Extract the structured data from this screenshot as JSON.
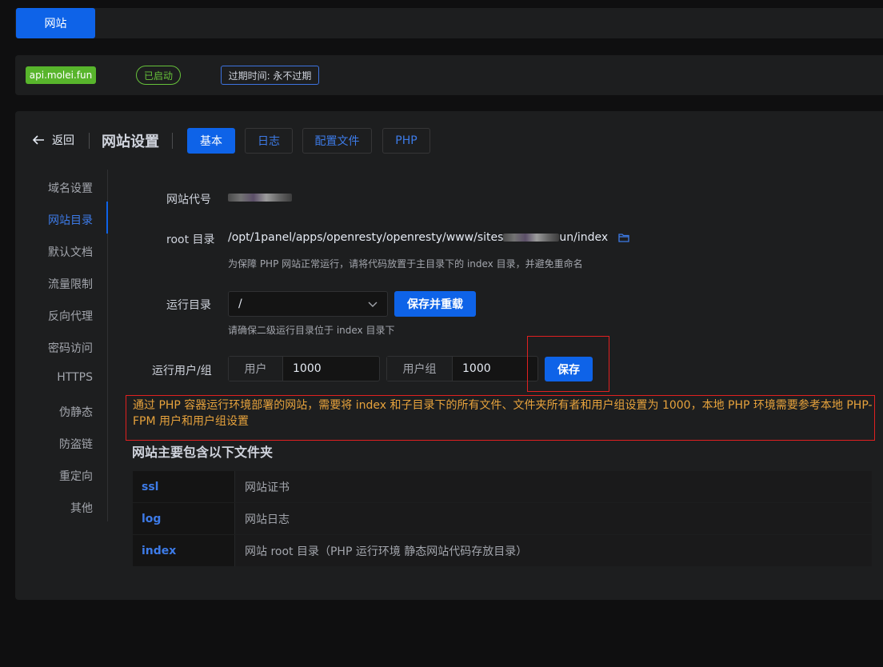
{
  "topbar": {
    "tab_label": "网站"
  },
  "status": {
    "site_name": "api.molei.fun",
    "state": "已启动",
    "expire": "过期时间: 永不过期"
  },
  "header": {
    "back_label": "返回",
    "title": "网站设置",
    "tabs": [
      {
        "label": "基本",
        "active": true
      },
      {
        "label": "日志",
        "active": false
      },
      {
        "label": "配置文件",
        "active": false
      },
      {
        "label": "PHP",
        "active": false
      }
    ]
  },
  "sidebar": {
    "items": [
      {
        "label": "域名设置"
      },
      {
        "label": "网站目录",
        "active": true
      },
      {
        "label": "默认文档"
      },
      {
        "label": "流量限制"
      },
      {
        "label": "反向代理"
      },
      {
        "label": "密码访问"
      },
      {
        "label": "HTTPS"
      },
      {
        "label": "伪静态"
      },
      {
        "label": "防盗链"
      },
      {
        "label": "重定向"
      },
      {
        "label": "其他"
      }
    ]
  },
  "form": {
    "site_code_label": "网站代号",
    "root_label": "root 目录",
    "root_prefix": "/opt/1panel/apps/openresty/openresty/www/sites",
    "root_suffix": "un/index",
    "root_hint": "为保障 PHP 网站正常运行，请将代码放置于主目录下的 index 目录，并避免重命名",
    "run_dir_label": "运行目录",
    "run_dir_value": "/",
    "save_reload_label": "保存并重载",
    "run_dir_hint": "请确保二级运行目录位于 index 目录下",
    "run_user_label": "运行用户/组",
    "user_prefix": "用户",
    "user_value": "1000",
    "group_prefix": "用户组",
    "group_value": "1000",
    "save_label": "保存"
  },
  "warning": "通过 PHP 容器运行环境部署的网站，需要将 index 和子目录下的所有文件、文件夹所有者和用户组设置为 1000，本地 PHP 环境需要参考本地 PHP-FPM 用户和用户组设置",
  "folders": {
    "title": "网站主要包含以下文件夹",
    "rows": [
      {
        "name": "ssl",
        "desc": "网站证书"
      },
      {
        "name": "log",
        "desc": "网站日志"
      },
      {
        "name": "index",
        "desc": "网站 root 目录（PHP 运行环境 静态网站代码存放目录）"
      }
    ]
  },
  "colors": {
    "primary": "#0e63e8",
    "success": "#67c23a",
    "warning": "#e6a23c",
    "annotation_red": "#e02020"
  }
}
